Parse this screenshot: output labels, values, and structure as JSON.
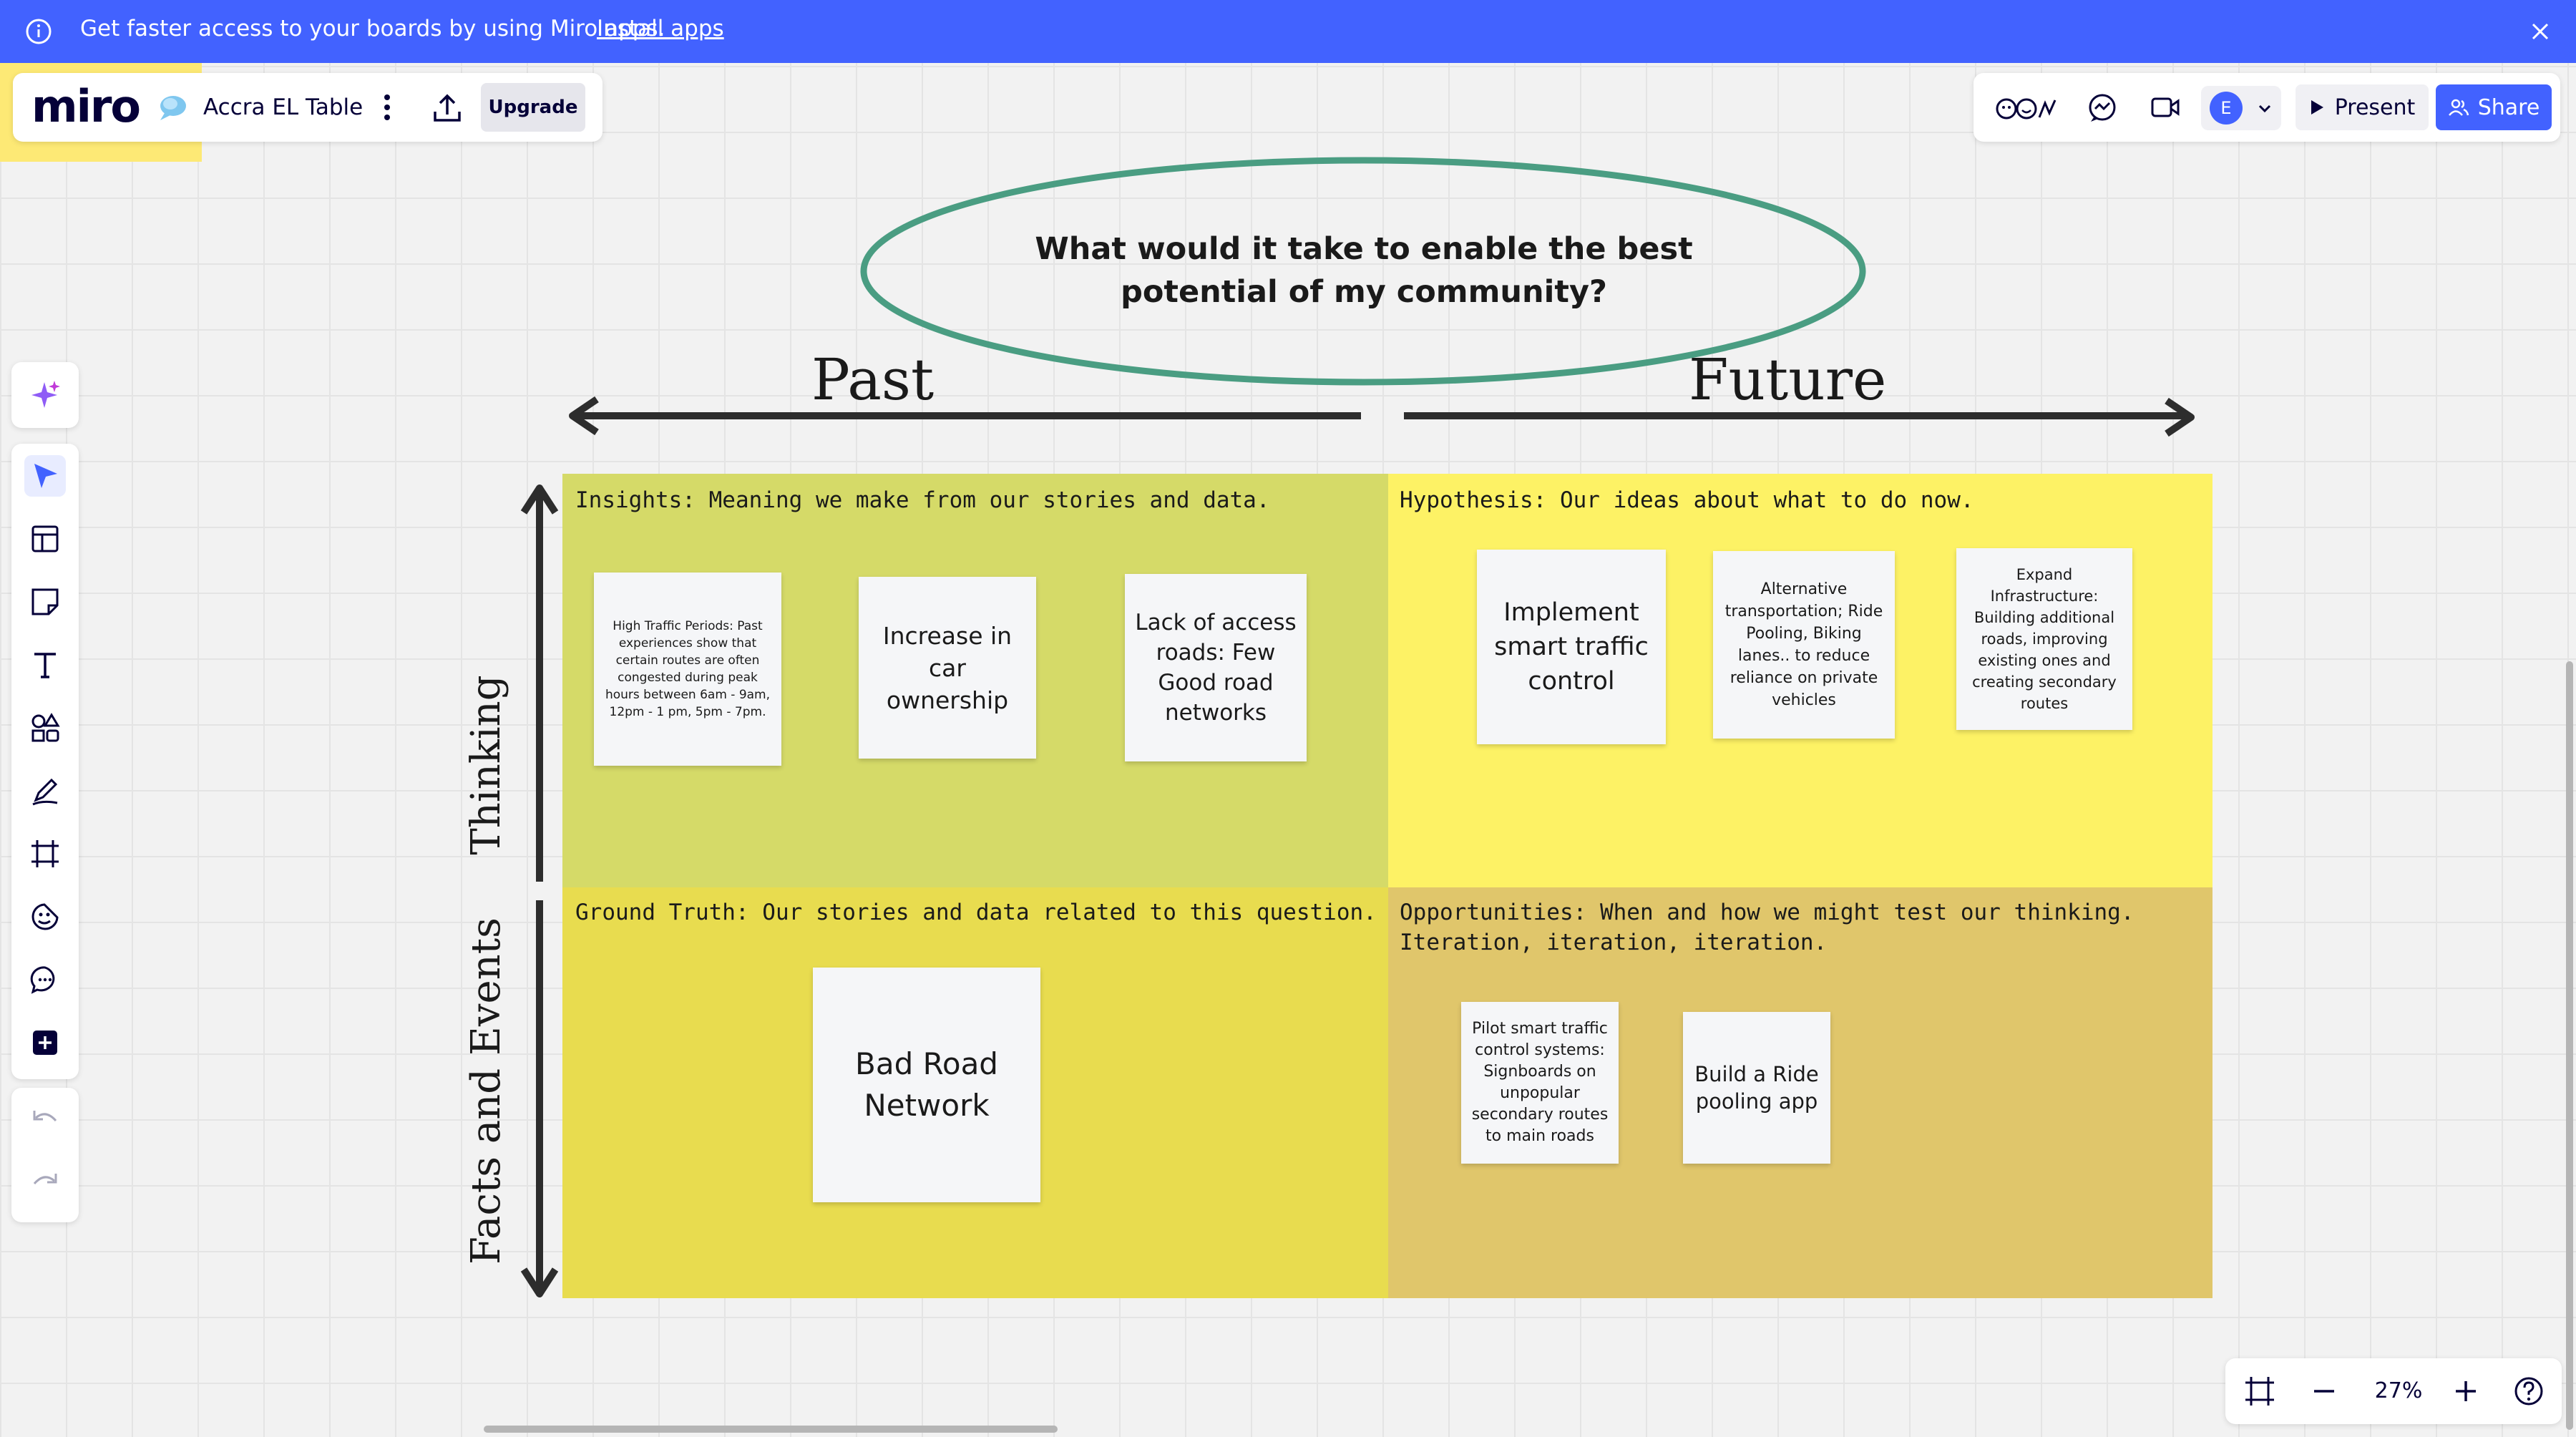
{
  "banner": {
    "text": "Get faster access to your boards by using Miro apps.",
    "link": "Install apps"
  },
  "board": {
    "logo": "miro",
    "title": "Accra EL Table",
    "upgrade_label": "Upgrade"
  },
  "topbar": {
    "avatar_initial": "E",
    "present_label": "Present",
    "share_label": "Share"
  },
  "canvas": {
    "question": "What would it take to enable the best potential of my community?",
    "past": "Past",
    "future": "Future",
    "thinking": "Thinking",
    "facts": "Facts and Events",
    "quadrants": {
      "insights": {
        "label": "Insights: Meaning we make from our stories and data.",
        "color": "#d5da68",
        "notes": [
          "High Traffic Periods: Past experiences show that certain routes are often congested during peak hours between 6am - 9am, 12pm - 1 pm, 5pm - 7pm.",
          "Increase in car ownership",
          "Lack of access roads: Few Good road networks"
        ]
      },
      "hypothesis": {
        "label": "Hypothesis: Our ideas about what to do now.",
        "color": "#fdf265",
        "notes": [
          "Implement smart traffic control",
          "Alternative transportation; Ride Pooling, Biking lanes.. to reduce reliance on private vehicles",
          "Expand Infrastructure: Building additional roads, improving existing ones and creating secondary routes"
        ]
      },
      "ground_truth": {
        "label": "Ground Truth: Our stories and data related to this question.",
        "color": "#e8dc4f",
        "notes": [
          "Bad Road Network"
        ]
      },
      "opportunities": {
        "label": "Opportunities: When and how we might test our thinking.\nIteration, iteration, iteration.",
        "color": "#e0c66b",
        "notes": [
          "Pilot smart traffic control systems: Signboards on unpopular secondary routes to main roads",
          "Build a Ride pooling app"
        ]
      }
    }
  },
  "zoom": {
    "level": "27%"
  },
  "colors": {
    "accent": "#4262ff",
    "ellipse": "#4a9d82"
  }
}
